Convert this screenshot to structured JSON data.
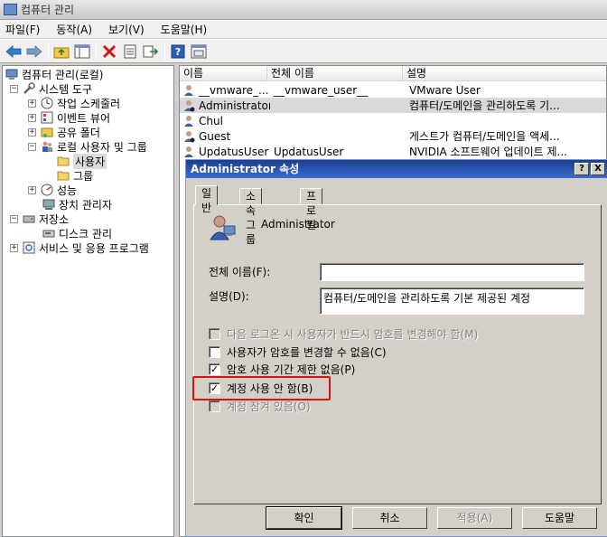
{
  "window": {
    "title": "컴퓨터 관리"
  },
  "menu": {
    "items": [
      "파일(F)",
      "동작(A)",
      "보기(V)",
      "도움말(H)"
    ]
  },
  "toolbar": {
    "buttons": [
      "back-arrow-icon",
      "forward-arrow-icon",
      "up-folder-icon",
      "show-hide-tree-icon",
      "delete-icon",
      "properties-icon",
      "export-icon",
      "help-icon",
      "console-view-icon"
    ]
  },
  "tree": {
    "root": "컴퓨터 관리(로컬)",
    "system_tools": "시스템 도구",
    "task_scheduler": "작업 스케줄러",
    "event_viewer": "이벤트 뷰어",
    "shared_folders": "공유 폴더",
    "local_users_groups": "로컬 사용자 및 그룹",
    "users": "사용자",
    "groups": "그룹",
    "performance": "성능",
    "device_manager": "장치 관리자",
    "storage": "저장소",
    "disk_management": "디스크 관리",
    "services_apps": "서비스 및 응용 프로그램"
  },
  "list": {
    "headers": [
      "이름",
      "전체 이름",
      "설명"
    ],
    "rows": [
      {
        "name": "__vmware_...",
        "full_name": "__vmware_user__",
        "description": "VMware User"
      },
      {
        "name": "Administrator",
        "full_name": "",
        "description": "컴퓨터/도메인을 관리하도록 기..."
      },
      {
        "name": "Chul",
        "full_name": "",
        "description": ""
      },
      {
        "name": "Guest",
        "full_name": "",
        "description": "게스트가 컴퓨터/도메인을 액세..."
      },
      {
        "name": "UpdatusUser",
        "full_name": "UpdatusUser",
        "description": "NVIDIA 소프트웨어 업데이트 제..."
      }
    ]
  },
  "dialog": {
    "title": "Administrator 속성",
    "help_btn": "?",
    "close_btn": "X",
    "tabs": [
      "일반",
      "소속 그룹",
      "프로필"
    ],
    "user_name": "Administrator",
    "full_name_label": "전체 이름(F):",
    "full_name_value": "",
    "description_label": "설명(D):",
    "description_value": "컴퓨터/도메인을 관리하도록 기본 제공된 계정",
    "checkboxes": [
      {
        "label": "다음 로그온 시 사용자가 반드시 암호를 변경해야 함(M)",
        "checked": false,
        "enabled": false
      },
      {
        "label": "사용자가 암호를 변경할 수 없음(C)",
        "checked": false,
        "enabled": true
      },
      {
        "label": "암호 사용 기간 제한 없음(P)",
        "checked": true,
        "enabled": true
      },
      {
        "label": "계정 사용 안 함(B)",
        "checked": true,
        "enabled": true
      },
      {
        "label": "계정 잠겨 있음(O)",
        "checked": false,
        "enabled": false
      }
    ],
    "buttons": {
      "ok": "확인",
      "cancel": "취소",
      "apply": "적용(A)",
      "help": "도움말"
    }
  },
  "colors": {
    "highlight_box": "#e01010",
    "dialog_title": "#1c3f8a"
  }
}
